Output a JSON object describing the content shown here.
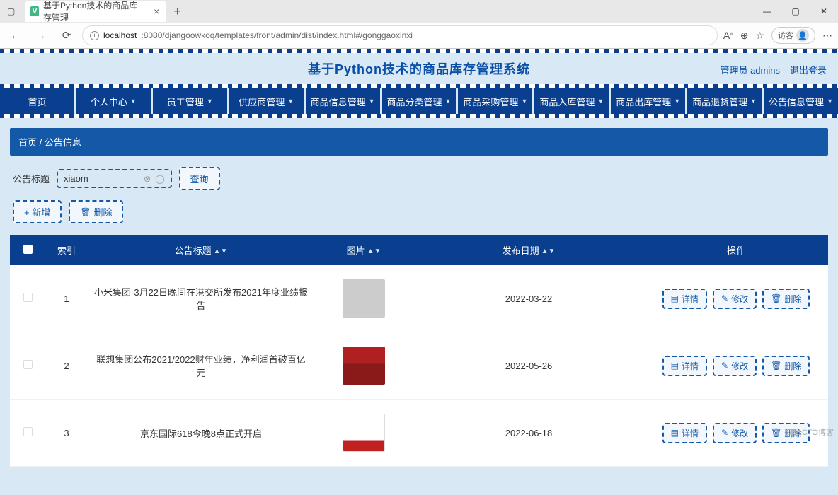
{
  "browser": {
    "tab_title": "基于Python技术的商品库存管理",
    "url_host": "localhost",
    "url_path": ":8080/djangoowkoq/templates/front/admin/dist/index.html#/gonggaoxinxi",
    "guest_label": "访客"
  },
  "banner": {
    "title": "基于Python技术的商品库存管理系统",
    "admin_label": "管理员 admins",
    "logout_label": "退出登录"
  },
  "nav": [
    {
      "label": "首页",
      "has_dropdown": false
    },
    {
      "label": "个人中心",
      "has_dropdown": true
    },
    {
      "label": "员工管理",
      "has_dropdown": true
    },
    {
      "label": "供应商管理",
      "has_dropdown": true
    },
    {
      "label": "商品信息管理",
      "has_dropdown": true
    },
    {
      "label": "商品分类管理",
      "has_dropdown": true
    },
    {
      "label": "商品采购管理",
      "has_dropdown": true
    },
    {
      "label": "商品入库管理",
      "has_dropdown": true
    },
    {
      "label": "商品出库管理",
      "has_dropdown": true
    },
    {
      "label": "商品退货管理",
      "has_dropdown": true
    },
    {
      "label": "公告信息管理",
      "has_dropdown": true
    }
  ],
  "breadcrumb": {
    "home": "首页",
    "sep": "/",
    "current": "公告信息"
  },
  "filter": {
    "label": "公告标题",
    "input_value": "xiaom",
    "query_btn": "查询"
  },
  "top_actions": {
    "add": "+ 新增",
    "delete_icon": "🗑",
    "delete": "删除"
  },
  "table": {
    "headers": {
      "index": "索引",
      "title": "公告标题",
      "image": "图片",
      "date": "发布日期",
      "ops": "操作"
    },
    "rows": [
      {
        "index": "1",
        "title": "小米集团-3月22日晚间在港交所发布2021年度业绩报告",
        "date": "2022-03-22",
        "thumb_class": ""
      },
      {
        "index": "2",
        "title": "联想集团公布2021/2022财年业绩，净利润首破百亿元",
        "date": "2022-05-26",
        "thumb_class": "lenovo"
      },
      {
        "index": "3",
        "title": "京东国际618今晚8点正式开启",
        "date": "2022-06-18",
        "thumb_class": "jd"
      }
    ],
    "row_ops": {
      "detail": "详情",
      "edit": "修改",
      "delete": "删除"
    }
  },
  "watermark": "@51CTO博客"
}
